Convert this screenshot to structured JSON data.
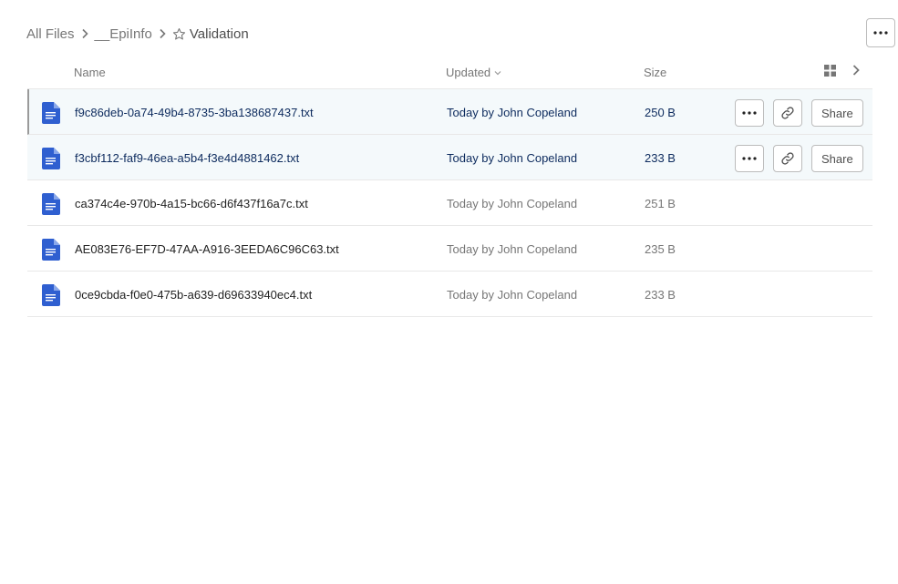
{
  "breadcrumb": {
    "items": [
      "All Files",
      "__EpiInfo"
    ],
    "current": "Validation"
  },
  "header": {
    "name": "Name",
    "updated": "Updated",
    "size": "Size"
  },
  "actions": {
    "share_label": "Share"
  },
  "files": [
    {
      "name": "f9c86deb-0a74-49b4-8735-3ba138687437.txt",
      "updated": "Today by John Copeland",
      "size": "250 B"
    },
    {
      "name": "f3cbf112-faf9-46ea-a5b4-f3e4d4881462.txt",
      "updated": "Today by John Copeland",
      "size": "233 B"
    },
    {
      "name": "ca374c4e-970b-4a15-bc66-d6f437f16a7c.txt",
      "updated": "Today by John Copeland",
      "size": "251 B"
    },
    {
      "name": "AE083E76-EF7D-47AA-A916-3EEDA6C96C63.txt",
      "updated": "Today by John Copeland",
      "size": "235 B"
    },
    {
      "name": "0ce9cbda-f0e0-475b-a639-d69633940ec4.txt",
      "updated": "Today by John Copeland",
      "size": "233 B"
    }
  ],
  "colors": {
    "file_icon": "#2f5fd0",
    "selected_text": "#0d2b5e",
    "row_highlight": "#f4f9fb"
  }
}
